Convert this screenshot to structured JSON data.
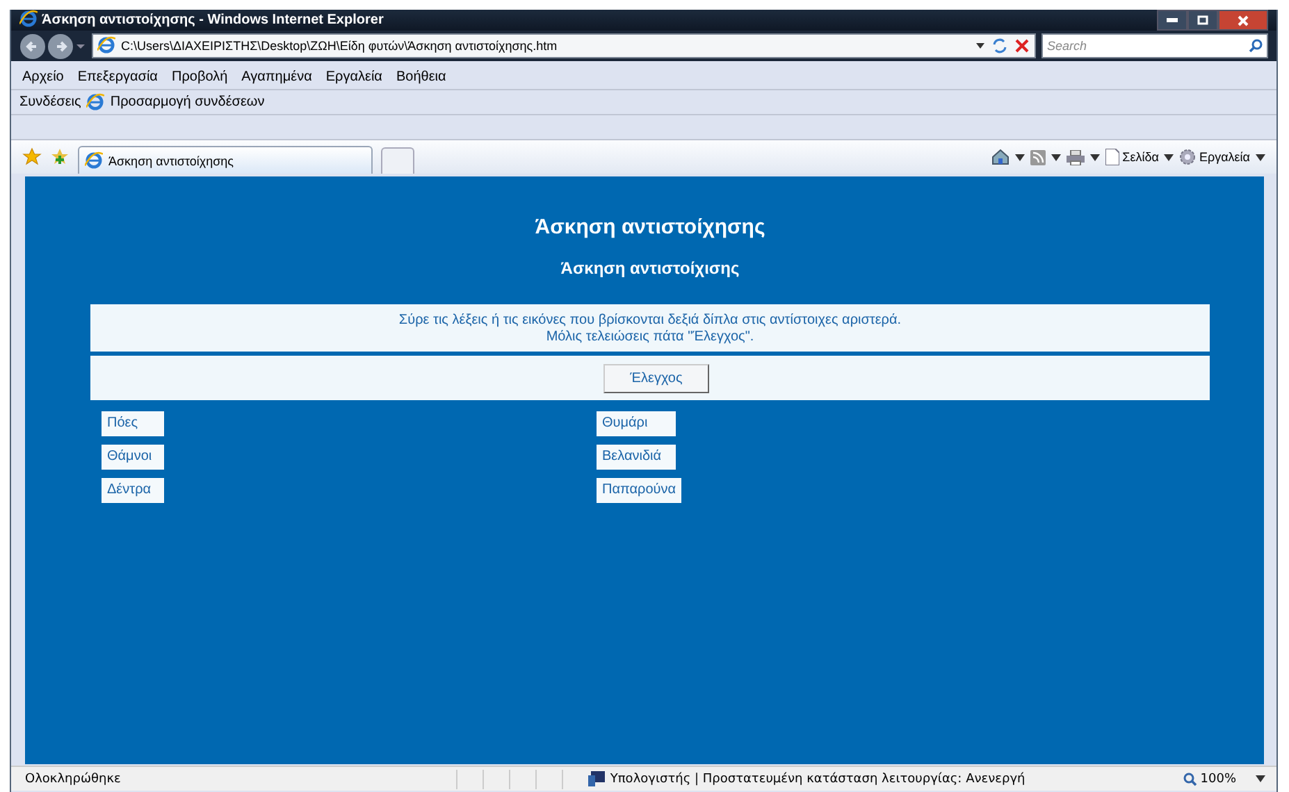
{
  "window": {
    "title": "Άσκηση αντιστοίχησης - Windows Internet Explorer"
  },
  "address_bar": {
    "value": "C:\\Users\\ΔΙΑΧΕΙΡΙΣΤΗΣ\\Desktop\\ΖΩΗ\\Είδη φυτών\\Άσκηση αντιστοίχησης.htm"
  },
  "search": {
    "placeholder": "Search"
  },
  "menu": [
    "Αρχείο",
    "Επεξεργασία",
    "Προβολή",
    "Αγαπημένα",
    "Εργαλεία",
    "Βοήθεια"
  ],
  "links_bar": {
    "label": "Συνδέσεις",
    "items": [
      "Προσαρμογή συνδέσεων"
    ]
  },
  "tabs": [
    {
      "label": "Άσκηση αντιστοίχησης",
      "selected": true
    }
  ],
  "command_bar": {
    "page": "Σελίδα",
    "tools": "Εργαλεία"
  },
  "page": {
    "title": "Άσκηση αντιστοίχησης",
    "subtitle": "Άσκηση αντιστοίχισης",
    "instructions": [
      "Σύρε τις λέξεις ή τις εικόνες που βρίσκονται δεξιά δίπλα στις αντίστοιχες αριστερά.",
      "Μόλις τελειώσεις πάτα \"Έλεγχος\"."
    ],
    "check_button": "Έλεγχος",
    "left_items": [
      "Πόες",
      "Θάμνοι",
      "Δέντρα"
    ],
    "right_items": [
      "Θυμάρι",
      "Βελανιδιά",
      "Παπαρούνα"
    ]
  },
  "status_bar": {
    "status": "Ολοκληρώθηκε",
    "zone": "Υπολογιστής | Προστατευμένη κατάσταση λειτουργίας: Ανενεργή",
    "zoom": "100%"
  }
}
